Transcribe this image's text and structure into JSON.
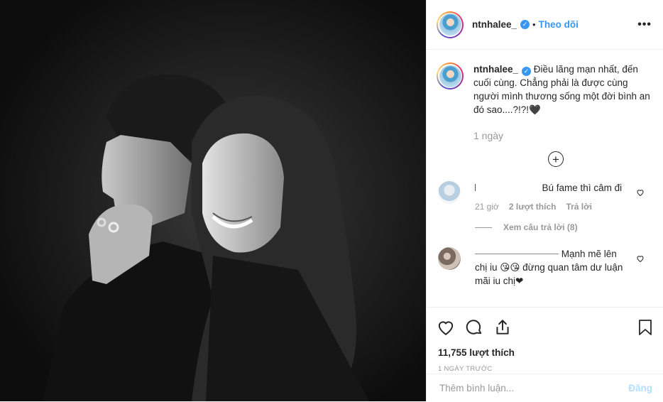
{
  "post": {
    "photo_alt": "black and white couple photo",
    "author": "ntnhalee_",
    "follow_label": "Theo dõi",
    "dot": "•",
    "more_label": "•••"
  },
  "caption": {
    "username": "ntnhalee_",
    "text": "Điều lãng mạn nhất, đến cuối cùng. Chẳng phải là được cùng người mình thương sống một đời bình an đó sao....?!?!🖤",
    "time": "1 ngày",
    "load_more": "+"
  },
  "comments": [
    {
      "username": "",
      "text": "Bú fame thì câm đi",
      "time": "21 giờ",
      "likes": "2 lượt thích",
      "reply": "Trả lời",
      "view_replies": "Xem câu trả lời (8)"
    },
    {
      "username": "",
      "text": "Mạnh mẽ lên chị iu 😘😘 đừng quan tâm dư luận mãi iu chị❤"
    }
  ],
  "actions": {
    "likes": "11,755 lượt thích",
    "posted": "1 NGÀY TRƯỚC"
  },
  "add_comment": {
    "placeholder": "Thêm bình luận...",
    "post_label": "Đăng"
  },
  "colors": {
    "link_blue": "#3897f0",
    "post_disabled": "#b2dffc",
    "muted": "#999999"
  }
}
